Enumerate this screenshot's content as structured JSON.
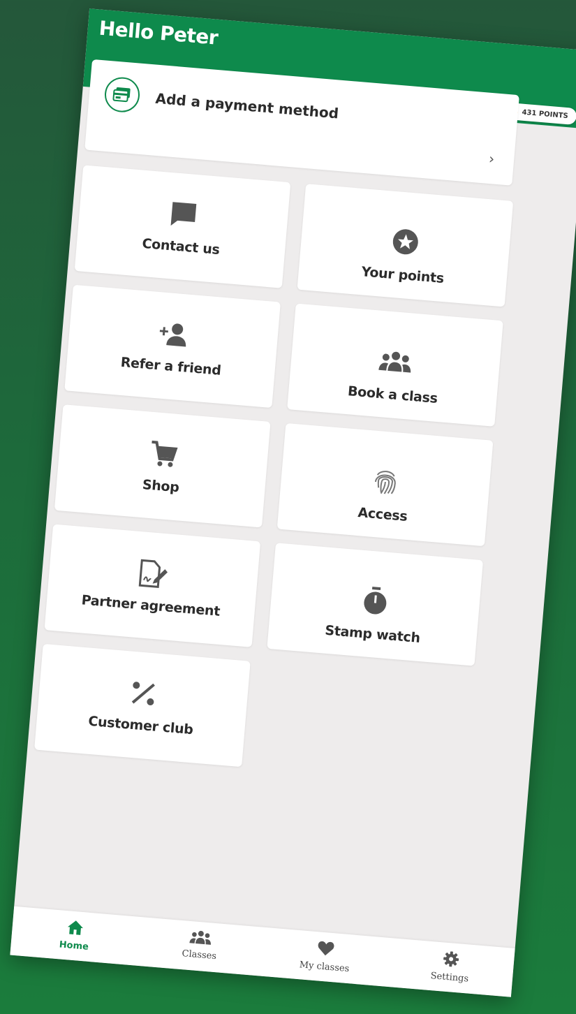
{
  "header": {
    "greeting": "Hello Peter",
    "points_label": "431 POINTS"
  },
  "payment": {
    "label": "Add a payment method",
    "chevron": "›",
    "icon": "payment-card-icon"
  },
  "tiles": [
    {
      "label": "Contact us",
      "icon": "chat-bubble-icon"
    },
    {
      "label": "Your points",
      "icon": "star-circle-icon"
    },
    {
      "label": "Refer a friend",
      "icon": "add-person-icon"
    },
    {
      "label": "Book a class",
      "icon": "group-icon"
    },
    {
      "label": "Shop",
      "icon": "cart-icon"
    },
    {
      "label": "Access",
      "icon": "fingerprint-icon"
    },
    {
      "label": "Partner agreement",
      "icon": "document-sign-icon"
    },
    {
      "label": "Stamp watch",
      "icon": "stopwatch-icon"
    },
    {
      "label": "Customer club",
      "icon": "percent-icon"
    }
  ],
  "nav": [
    {
      "label": "Home",
      "icon": "home-icon",
      "active": true
    },
    {
      "label": "Classes",
      "icon": "group-icon",
      "active": false
    },
    {
      "label": "My classes",
      "icon": "heart-icon",
      "active": false
    },
    {
      "label": "Settings",
      "icon": "gear-icon",
      "active": false
    }
  ],
  "colors": {
    "primary": "#0e8a4c",
    "icon_gray": "#555555",
    "coin": "#f2a21a"
  }
}
